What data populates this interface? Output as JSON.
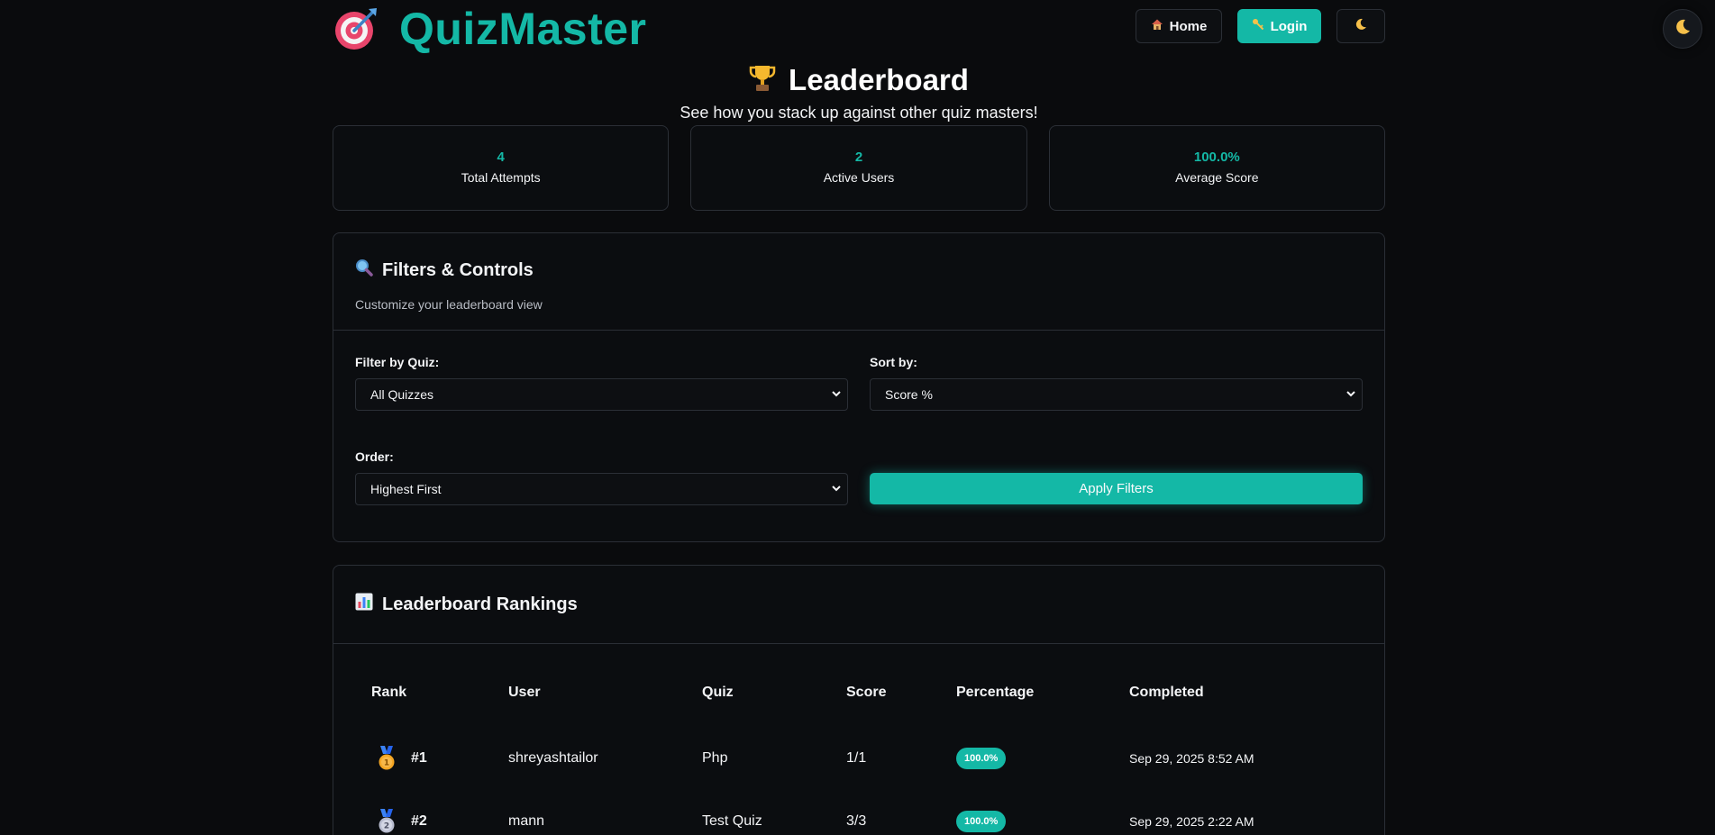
{
  "brand": {
    "name": "QuizMaster"
  },
  "nav": {
    "home_label": "Home",
    "login_label": "Login"
  },
  "page": {
    "title": "Leaderboard",
    "subtitle": "See how you stack up against other quiz masters!"
  },
  "stats": [
    {
      "value": "4",
      "label": "Total Attempts"
    },
    {
      "value": "2",
      "label": "Active Users"
    },
    {
      "value": "100.0%",
      "label": "Average Score"
    }
  ],
  "filters": {
    "title": "Filters & Controls",
    "description": "Customize your leaderboard view",
    "quiz_label": "Filter by Quiz:",
    "quiz_value": "All Quizzes",
    "sort_label": "Sort by:",
    "sort_value": "Score %",
    "order_label": "Order:",
    "order_value": "Highest First",
    "apply_label": "Apply Filters"
  },
  "rankings": {
    "title": "Leaderboard Rankings",
    "columns": [
      "Rank",
      "User",
      "Quiz",
      "Score",
      "Percentage",
      "Completed"
    ],
    "rows": [
      {
        "rank": "#1",
        "user": "shreyashtailor",
        "quiz": "Php",
        "score": "1/1",
        "percentage": "100.0%",
        "completed": "Sep 29, 2025 8:52 AM"
      },
      {
        "rank": "#2",
        "user": "mann",
        "quiz": "Test Quiz",
        "score": "3/3",
        "percentage": "100.0%",
        "completed": "Sep 29, 2025 2:22 AM"
      }
    ]
  },
  "colors": {
    "accent": "#14b8a6",
    "background": "#0a0b0d",
    "border": "#2b2f36"
  },
  "icons": [
    "target-icon",
    "house-icon",
    "key-icon",
    "moon-icon",
    "trophy-icon",
    "magnifier-icon",
    "bar-chart-icon",
    "gold-medal-icon",
    "silver-medal-icon"
  ]
}
